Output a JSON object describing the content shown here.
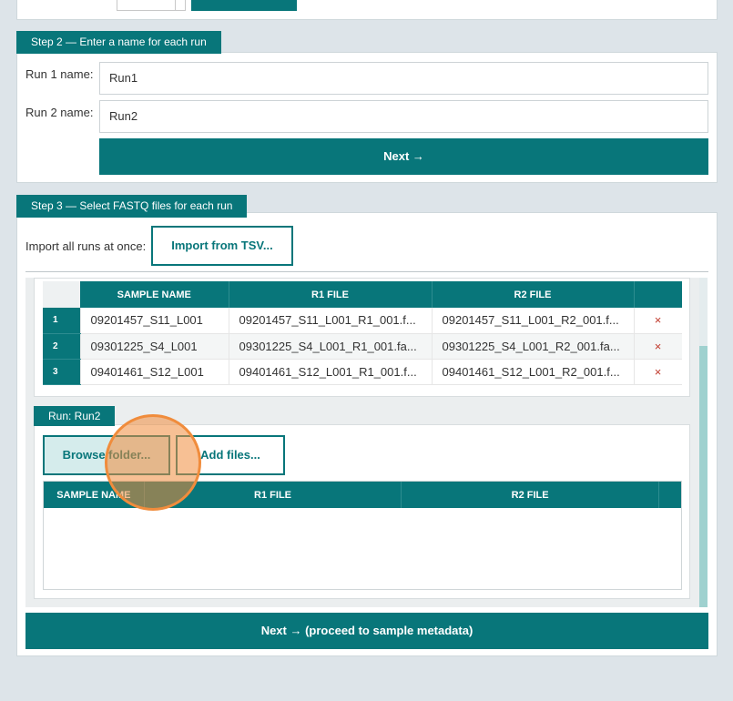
{
  "step2": {
    "tab": "Step 2 — Enter a name for each run",
    "run1_label": "Run 1 name:",
    "run1_value": "Run1",
    "run2_label": "Run 2 name:",
    "run2_value": "Run2",
    "next_label": "Next →"
  },
  "step3": {
    "tab": "Step 3 — Select FASTQ files for each run",
    "import_label": "Import all runs at once:",
    "import_button": "Import from TSV...",
    "table": {
      "headers": [
        "SAMPLE NAME",
        "R1 FILE",
        "R2 FILE"
      ],
      "rows": [
        {
          "num": "1",
          "sample": "09201457_S11_L001",
          "r1": "09201457_S11_L001_R1_001.f...",
          "r2": "09201457_S11_L001_R2_001.f...",
          "delete": "×"
        },
        {
          "num": "2",
          "sample": "09301225_S4_L001",
          "r1": "09301225_S4_L001_R1_001.fa...",
          "r2": "09301225_S4_L001_R2_001.fa...",
          "delete": "×"
        },
        {
          "num": "3",
          "sample": "09401461_S12_L001",
          "r1": "09401461_S12_L001_R1_001.f...",
          "r2": "09401461_S12_L001_R2_001.f...",
          "delete": "×"
        }
      ]
    },
    "run2": {
      "tab": "Run: Run2",
      "browse_button": "Browse folder...",
      "add_button": "Add files...",
      "headers": [
        "SAMPLE NAME",
        "R1 FILE",
        "R2 FILE"
      ]
    },
    "next_label": "Next →  (proceed to sample metadata)"
  },
  "colors": {
    "accent": "#08767a",
    "highlight": "#f08c3c"
  }
}
